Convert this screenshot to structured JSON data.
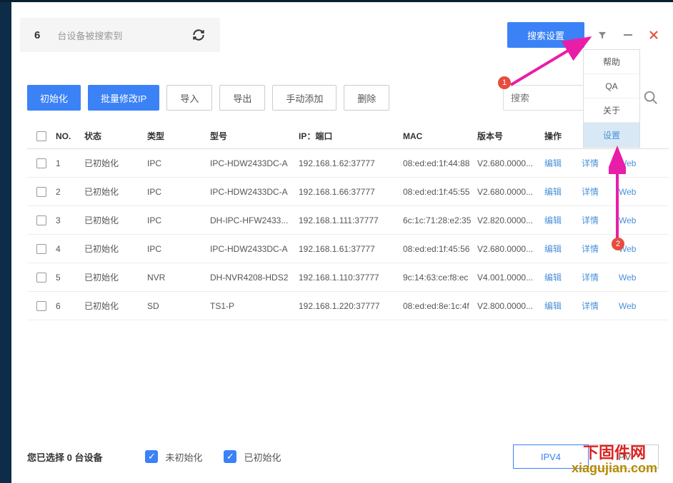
{
  "header": {
    "device_count": "6",
    "device_count_text": "台设备被搜索到",
    "search_settings_btn": "搜索设置"
  },
  "dropdown": {
    "items": [
      "帮助",
      "QA",
      "关于",
      "设置"
    ]
  },
  "toolbar": {
    "initialize": "初始化",
    "batch_modify_ip": "批量修改IP",
    "import": "导入",
    "export": "导出",
    "manual_add": "手动添加",
    "delete": "删除",
    "search_placeholder": "搜索"
  },
  "table": {
    "headers": {
      "no": "NO.",
      "status": "状态",
      "type": "类型",
      "model": "型号",
      "ip_port": "IP：端口",
      "mac": "MAC",
      "version": "版本号",
      "operation": "操作"
    },
    "action_labels": {
      "edit": "编辑",
      "detail": "详情",
      "web": "Web"
    },
    "rows": [
      {
        "no": "1",
        "status": "已初始化",
        "type": "IPC",
        "model": "IPC-HDW2433DC-A",
        "ip": "192.168.1.62:37777",
        "mac": "08:ed:ed:1f:44:88",
        "version": "V2.680.0000..."
      },
      {
        "no": "2",
        "status": "已初始化",
        "type": "IPC",
        "model": "IPC-HDW2433DC-A",
        "ip": "192.168.1.66:37777",
        "mac": "08:ed:ed:1f:45:55",
        "version": "V2.680.0000..."
      },
      {
        "no": "3",
        "status": "已初始化",
        "type": "IPC",
        "model": "DH-IPC-HFW2433...",
        "ip": "192.168.1.111:37777",
        "mac": "6c:1c:71:28:e2:35",
        "version": "V2.820.0000..."
      },
      {
        "no": "4",
        "status": "已初始化",
        "type": "IPC",
        "model": "IPC-HDW2433DC-A",
        "ip": "192.168.1.61:37777",
        "mac": "08:ed:ed:1f:45:56",
        "version": "V2.680.0000..."
      },
      {
        "no": "5",
        "status": "已初始化",
        "type": "NVR",
        "model": "DH-NVR4208-HDS2",
        "ip": "192.168.1.110:37777",
        "mac": "9c:14:63:ce:f8:ec",
        "version": "V4.001.0000..."
      },
      {
        "no": "6",
        "status": "已初始化",
        "type": "SD",
        "model": "TS1-P",
        "ip": "192.168.1.220:37777",
        "mac": "08:ed:ed:8e:1c:4f",
        "version": "V2.800.0000..."
      }
    ]
  },
  "footer": {
    "selected_text": "您已选择 0 台设备",
    "uninitialized": "未初始化",
    "initialized": "已初始化",
    "ipv4": "IPV4",
    "ipv6": "IPV"
  },
  "annotations": {
    "marker1": "1",
    "marker2": "2"
  },
  "watermark": {
    "line1": "下固件网",
    "line2": "xiagujian.com"
  }
}
